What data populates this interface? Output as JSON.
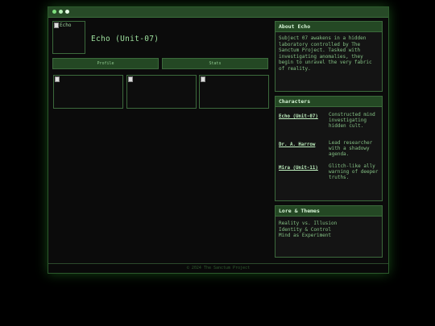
{
  "window": {
    "title_dots": [
      "green",
      "light-green",
      "white"
    ]
  },
  "profile": {
    "avatar_alt": "Echo",
    "name": "Echo (Unit-07)"
  },
  "tabs": [
    {
      "label": "Profile"
    },
    {
      "label": "Stats"
    }
  ],
  "about": {
    "heading": "About Echo",
    "text": "Subject 07 awakens in a hidden laboratory controlled by The Sanctum Project. Tasked with investigating anomalies, they begin to unravel the very fabric of reality."
  },
  "characters": {
    "heading": "Characters",
    "items": [
      {
        "name": "Echo (Unit-07)",
        "desc": "Constructed mind investigating hidden cult."
      },
      {
        "name": "Dr. A. Harrow",
        "desc": "Lead researcher with a shadowy agenda."
      },
      {
        "name": "Mira (Unit-11)",
        "desc": "Glitch-like ally warning of deeper truths."
      }
    ]
  },
  "lore": {
    "heading": "Lore & Themes",
    "items": [
      "Reality vs. Illusion",
      "Identity & Control",
      "Mind as Experiment"
    ]
  },
  "footer": {
    "text": "© 2024 The Sanctum Project"
  },
  "colors": {
    "accent": "#9ee09e",
    "header_bg": "#244824",
    "border": "#3c6a3c",
    "background": "#000000"
  }
}
